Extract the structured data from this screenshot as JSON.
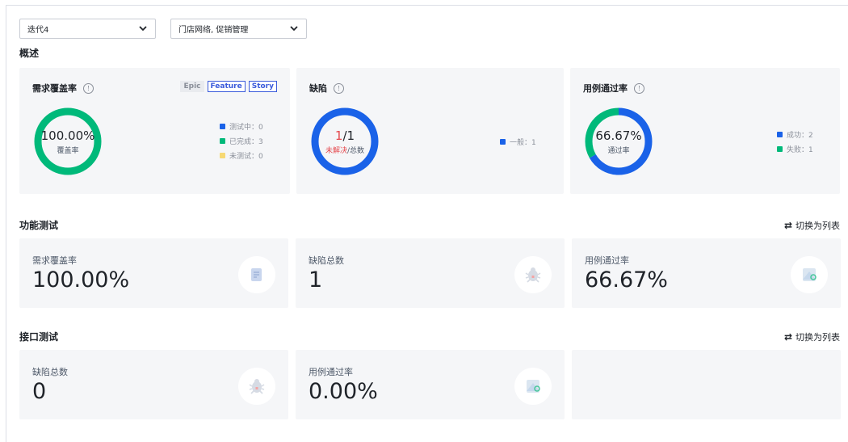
{
  "filters": {
    "iteration": "迭代4",
    "modules": "门店网络, 促销管理"
  },
  "overview": {
    "title": "概述",
    "requirement_coverage": {
      "title": "需求覆盖率",
      "tags": [
        "Epic",
        "Feature",
        "Story"
      ],
      "active_tags": [
        "Feature",
        "Story"
      ],
      "center_value": "100.00%",
      "center_label": "覆盖率",
      "legend": [
        {
          "label": "测试中：0",
          "color": "#1a62e8"
        },
        {
          "label": "已完成：3",
          "color": "#00b97a"
        },
        {
          "label": "未测试：0",
          "color": "#f7d974"
        }
      ],
      "chart_data": {
        "type": "pie",
        "categories": [
          "测试中",
          "已完成",
          "未测试"
        ],
        "values": [
          0,
          3,
          0
        ]
      }
    },
    "defects": {
      "title": "缺陷",
      "center_unresolved": "1",
      "center_total": "/1",
      "center_label_unresolved": "未解决",
      "center_label_total": "/总数",
      "legend": [
        {
          "label": "一般：1",
          "color": "#1a62e8"
        }
      ],
      "chart_data": {
        "type": "pie",
        "categories": [
          "一般"
        ],
        "values": [
          1
        ]
      }
    },
    "case_pass_rate": {
      "title": "用例通过率",
      "center_value": "66.67%",
      "center_label": "通过率",
      "legend": [
        {
          "label": "成功：2",
          "color": "#1a62e8"
        },
        {
          "label": "失败：1",
          "color": "#00b97a"
        }
      ],
      "chart_data": {
        "type": "pie",
        "categories": [
          "成功",
          "失败"
        ],
        "values": [
          2,
          1
        ]
      }
    }
  },
  "functional_test": {
    "title": "功能测试",
    "switch_label": "切换为列表",
    "metrics": [
      {
        "label": "需求覆盖率",
        "value": "100.00%",
        "icon": "document-icon"
      },
      {
        "label": "缺陷总数",
        "value": "1",
        "icon": "bug-icon"
      },
      {
        "label": "用例通过率",
        "value": "66.67%",
        "icon": "test-case-icon"
      }
    ]
  },
  "api_test": {
    "title": "接口测试",
    "switch_label": "切换为列表",
    "metrics": [
      {
        "label": "缺陷总数",
        "value": "0",
        "icon": "bug-icon"
      },
      {
        "label": "用例通过率",
        "value": "0.00%",
        "icon": "test-case-icon"
      }
    ]
  },
  "colors": {
    "blue": "#1a62e8",
    "green": "#00b97a",
    "yellow": "#f7d974",
    "red": "#e5484d",
    "card_bg": "#f5f6f8"
  }
}
